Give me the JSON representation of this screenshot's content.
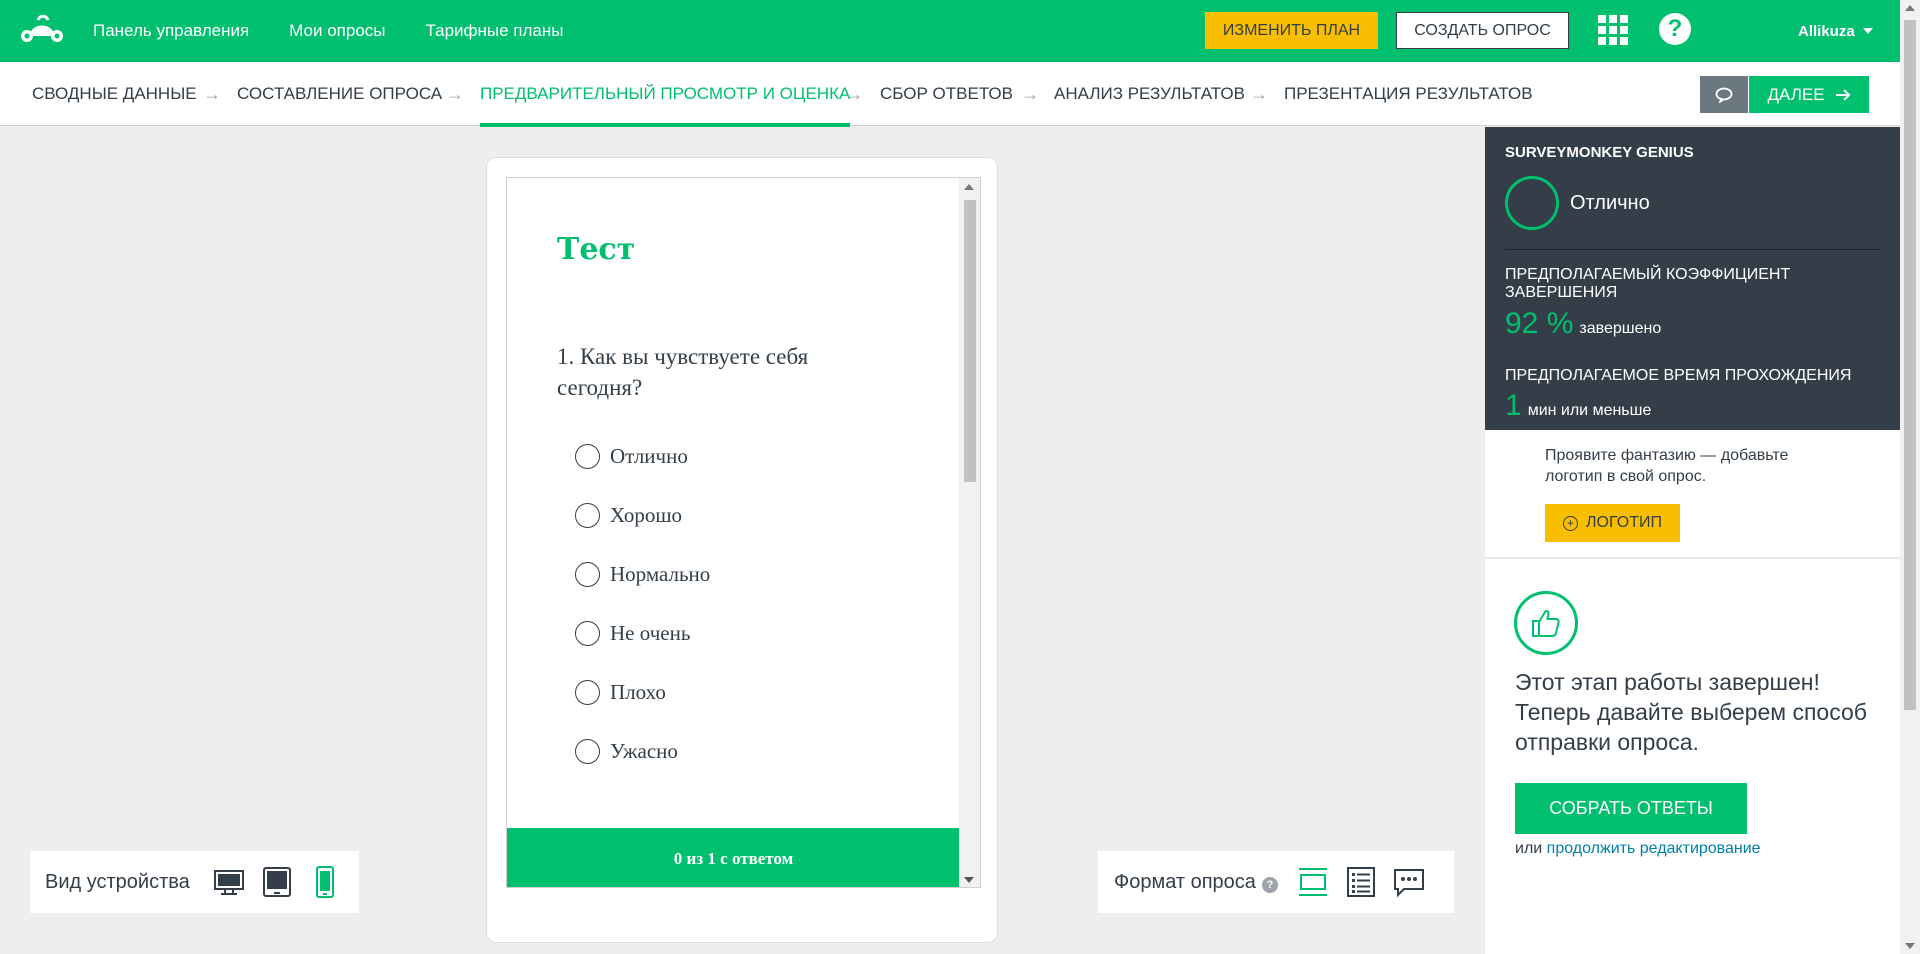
{
  "topnav": {
    "items": [
      "Панель управления",
      "Мои опросы",
      "Тарифные планы"
    ],
    "upgrade_label": "ИЗМЕНИТЬ ПЛАН",
    "create_label": "СОЗДАТЬ ОПРОС",
    "help_glyph": "?",
    "username": "Allikuza"
  },
  "steps": {
    "items": [
      "СВОДНЫЕ ДАННЫЕ",
      "СОСТАВЛЕНИЕ ОПРОСА",
      "ПРЕДВАРИТЕЛЬНЫЙ ПРОСМОТР И ОЦЕНКА",
      "СБОР ОТВЕТОВ",
      "АНАЛИЗ РЕЗУЛЬТАТОВ",
      "ПРЕЗЕНТАЦИЯ РЕЗУЛЬТАТОВ"
    ],
    "active_index": 2,
    "next_label": "ДАЛЕЕ"
  },
  "survey": {
    "title": "Тест",
    "question": "1. Как вы чувствуете себя сегодня?",
    "options": [
      "Отлично",
      "Хорошо",
      "Нормально",
      "Не очень",
      "Плохо",
      "Ужасно"
    ],
    "progress": "0 из 1 с ответом"
  },
  "device": {
    "label": "Вид устройства",
    "icons": [
      "desktop-icon",
      "tablet-icon",
      "mobile-icon"
    ],
    "selected": "mobile-icon"
  },
  "format": {
    "label": "Формат опроса",
    "info_glyph": "?",
    "icons": [
      "one-question-icon",
      "classic-icon",
      "conversation-icon"
    ],
    "selected": "one-question-icon"
  },
  "genius": {
    "title": "SURVEYMONKEY GENIUS",
    "rating": "Отлично",
    "completion_label": "ПРЕДПОЛАГАЕМЫЙ КОЭФФИЦИЕНТ ЗАВЕРШЕНИЯ",
    "completion_value": "92 %",
    "completion_unit": "завершено",
    "time_label": "ПРЕДПОЛАГАЕМОЕ ВРЕМЯ ПРОХОЖДЕНИЯ",
    "time_value": "1",
    "time_unit": "мин или меньше"
  },
  "panel": {
    "logo_tip": "Проявите фантазию — добавьте логотип в свой опрос.",
    "logo_button": "ЛОГОТИП",
    "plus_glyph": "+",
    "done_text": "Этот этап работы завершен! Теперь давайте выберем способ отправки опроса.",
    "collect_button": "СОБРАТЬ ОТВЕТЫ",
    "alt_prefix": "или",
    "alt_link": "продолжить редактирование"
  },
  "colors": {
    "brand": "#00bf6f",
    "dark": "#333e48",
    "yellow": "#f9be00"
  }
}
